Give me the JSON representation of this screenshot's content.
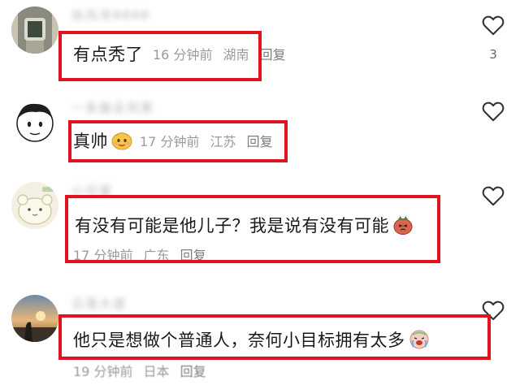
{
  "comments": [
    {
      "username": "扶风寻8888",
      "text": "有点秃了",
      "time": "16 分钟前",
      "location": "湖南",
      "reply": "回复",
      "likes": "3",
      "avatar_icon": "watch-photo-icon"
    },
    {
      "username": "一条路走到黑",
      "text": "真帅",
      "time": "17 分钟前",
      "location": "江苏",
      "reply": "回复",
      "likes": "",
      "emoji_icon": "smiling-blob-emoji-icon",
      "avatar_icon": "cartoon-face-icon"
    },
    {
      "username": "小可爱",
      "text": "有没有可能是他儿子？我是说有没有可能",
      "time": "17 分钟前",
      "location": "广东",
      "reply": "回复",
      "likes": "",
      "emoji_icon": "shy-pig-emoji-icon",
      "avatar_icon": "cute-animal-icon"
    },
    {
      "username": "日落大道",
      "text": "他只是想做个普通人，奈何小目标拥有太多",
      "time": "19 分钟前",
      "location": "日本",
      "reply": "回复",
      "likes": "",
      "emoji_icon": "crying-laugh-emoji-icon",
      "avatar_icon": "sunset-photo-icon"
    }
  ],
  "colors": {
    "highlight": "#e0141e",
    "meta_text": "#9a9a9a",
    "body_text": "#1a1a1a"
  }
}
